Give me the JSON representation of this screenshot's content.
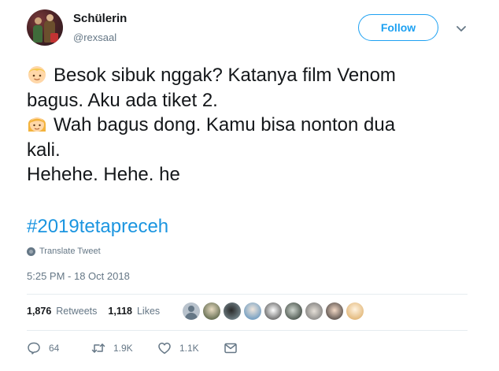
{
  "user": {
    "display_name": "Schülerin",
    "handle": "@rexsaal"
  },
  "follow_label": "Follow",
  "tweet": {
    "lines": [
      "Besok sibuk nggak? Katanya film Venom",
      "bagus. Aku ada tiket 2.",
      "Wah bagus dong. Kamu bisa nonton dua",
      "kali.",
      "Hehehe. Hehe. he"
    ],
    "emojis": [
      "boy-emoji",
      "girl-emoji"
    ],
    "hashtag": "#2019tetapreceh"
  },
  "translate_label": "Translate Tweet",
  "timestamp": "5:25 PM - 18 Oct 2018",
  "stats": {
    "retweets_count": "1,876",
    "retweets_label": "Retweets",
    "likes_count": "1,118",
    "likes_label": "Likes"
  },
  "actions": {
    "replies": "64",
    "retweets": "1.9K",
    "likes": "1.1K"
  },
  "colors": {
    "accent": "#1da1f2",
    "hashtag": "#1b95e0",
    "secondary_text": "#657786",
    "divider": "#e6ecf0"
  },
  "icons": [
    "globe-icon",
    "chevron-down-icon",
    "reply-icon",
    "retweet-icon",
    "heart-icon",
    "message-icon"
  ]
}
